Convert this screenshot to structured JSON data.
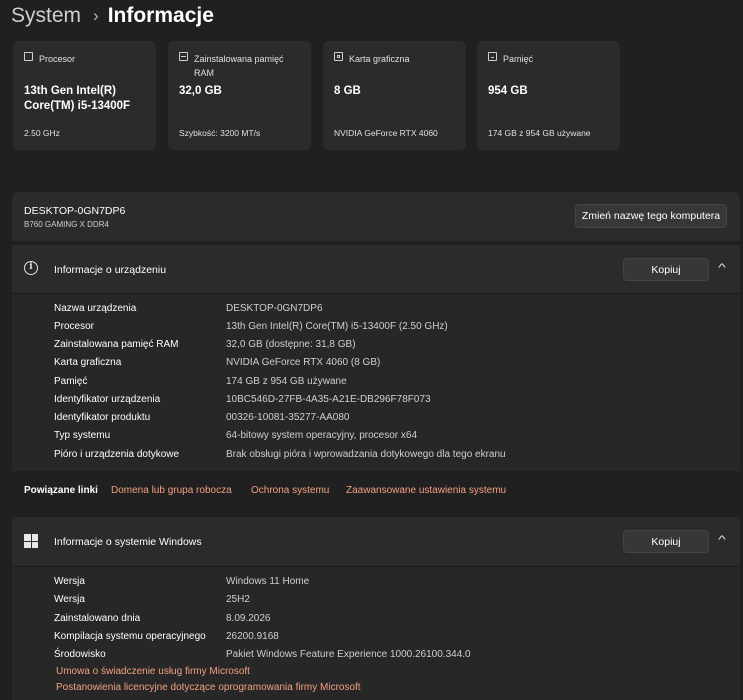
{
  "breadcrumb": {
    "parent": "System",
    "separator": "›",
    "current": "Informacje"
  },
  "cards": [
    {
      "icon": "processor-icon",
      "label": "Procesor",
      "value": "13th Gen Intel(R) Core(TM) i5-13400F",
      "sub": "2.50 GHz"
    },
    {
      "icon": "ram-icon",
      "label": "Zainstalowana pamięć RAM",
      "value": "32,0 GB",
      "sub": "Szybkość: 3200 MT/s"
    },
    {
      "icon": "graphics-card-icon",
      "label": "Karta graficzna",
      "value": "8 GB",
      "sub": "NVIDIA GeForce RTX 4060"
    },
    {
      "icon": "storage-icon",
      "label": "Pamięć",
      "value": "954 GB",
      "sub": "174 GB z 954 GB używane"
    }
  ],
  "device": {
    "name": "DESKTOP-0GN7DP6",
    "model": "B760 GAMING X DDR4",
    "rename_label": "Zmień nazwę tego komputera"
  },
  "device_info": {
    "title": "Informacje o urządzeniu",
    "copy_label": "Kopiuj",
    "chevron": "^",
    "rows": [
      {
        "k": "Nazwa urządzenia",
        "v": "DESKTOP-0GN7DP6"
      },
      {
        "k": "Procesor",
        "v": "13th Gen Intel(R) Core(TM) i5-13400F (2.50 GHz)"
      },
      {
        "k": "Zainstalowana pamięć RAM",
        "v": "32,0 GB (dostępne: 31,8 GB)"
      },
      {
        "k": "Karta graficzna",
        "v": "NVIDIA GeForce RTX 4060 (8 GB)"
      },
      {
        "k": "Pamięć",
        "v": "174 GB z 954 GB używane"
      },
      {
        "k": "Identyfikator urządzenia",
        "v": "10BC546D-27FB-4A35-A21E-DB296F78F073"
      },
      {
        "k": "Identyfikator produktu",
        "v": "00326-10081-35277-AA080"
      },
      {
        "k": "Typ systemu",
        "v": "64-bitowy system operacyjny, procesor x64"
      },
      {
        "k": "Pióro i urządzenia dotykowe",
        "v": "Brak obsługi pióra i wprowadzania dotykowego dla tego ekranu"
      }
    ]
  },
  "related": {
    "title": "Powiązane linki",
    "links": [
      "Domena lub grupa robocza",
      "Ochrona systemu",
      "Zaawansowane ustawienia systemu"
    ]
  },
  "windows_info": {
    "title": "Informacje o systemie Windows",
    "copy_label": "Kopiuj",
    "chevron": "^",
    "rows": [
      {
        "k": "Wersja",
        "v": "Windows 11 Home"
      },
      {
        "k": "Wersja",
        "v": "25H2"
      },
      {
        "k": "Zainstalowano dnia",
        "v": "8.09.2026"
      },
      {
        "k": "Kompilacja systemu operacyjnego",
        "v": "26200.9168"
      },
      {
        "k": "Środowisko",
        "v": "Pakiet Windows Feature Experience 1000.26100.344.0"
      }
    ],
    "links": [
      "Umowa o świadczenie usług firmy Microsoft",
      "Postanowienia licencyjne dotyczące oprogramowania firmy Microsoft"
    ]
  },
  "colors": {
    "background": "#202020",
    "card": "#2b2b2b",
    "link": "#f2a081"
  }
}
